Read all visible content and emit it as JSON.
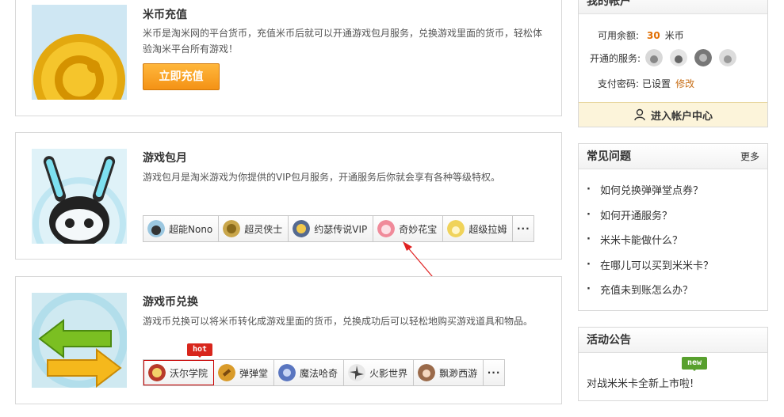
{
  "recharge": {
    "title": "米币充值",
    "desc": "米币是淘米网的平台货币，充值米币后就可以开通游戏包月服务，兑换游戏里面的货币，轻松体验淘米平台所有游戏！",
    "button": "立即充值"
  },
  "monthly": {
    "title": "游戏包月",
    "desc": "游戏包月是淘米游戏为你提供的VIP包月服务，开通服务后你就会享有各种等级特权。",
    "games": [
      {
        "label": "超能Nono",
        "icon": "nono-icon",
        "color": "#9bc7e0"
      },
      {
        "label": "超灵侠士",
        "icon": "xiashi-icon",
        "color": "#c9a64a"
      },
      {
        "label": "约瑟传说VIP",
        "icon": "vip-icon",
        "color": "#556a90"
      },
      {
        "label": "奇妙花宝",
        "icon": "huabao-icon",
        "color": "#f08a9a"
      },
      {
        "label": "超级拉姆",
        "icon": "lamu-icon",
        "color": "#f0d35a"
      }
    ],
    "more": "···"
  },
  "exchange": {
    "title": "游戏币兑换",
    "desc": "游戏币兑换可以将米币转化成游戏里面的货币，兑换成功后可以轻松地购买游戏道具和物品。",
    "hot_badge": "hot",
    "games": [
      {
        "label": "沃尔学院",
        "icon": "woer-icon",
        "color": "#b83a2a"
      },
      {
        "label": "弹弹堂",
        "icon": "dandantang-icon",
        "color": "#d99b2a"
      },
      {
        "label": "魔法哈奇",
        "icon": "haqi-icon",
        "color": "#5a76c0"
      },
      {
        "label": "火影世界",
        "icon": "huoying-icon",
        "color": "#444444"
      },
      {
        "label": "飘渺西游",
        "icon": "xiyou-icon",
        "color": "#9a6a4a"
      }
    ],
    "more": "···"
  },
  "account": {
    "title": "我的帐户",
    "balance_label": "可用余额:",
    "balance_value": "30",
    "balance_unit": "米币",
    "services_label": "开通的服务:",
    "service_icons": [
      "seer-icon",
      "nono-icon",
      "vip-icon",
      "bunny-icon"
    ],
    "password_label": "支付密码:",
    "password_status": "已设置",
    "password_action": "修改",
    "enter_center": "进入帐户中心"
  },
  "faq": {
    "title": "常见问题",
    "more": "更多",
    "items": [
      "如何兑换弹弹堂点券？",
      "如何开通服务？",
      "米米卡能做什么？",
      "在哪儿可以买到米米卡？",
      "充值未到账怎么办？"
    ]
  },
  "notice": {
    "title": "活动公告",
    "new_badge": "new",
    "text": "对战米米卡全新上市啦!"
  }
}
